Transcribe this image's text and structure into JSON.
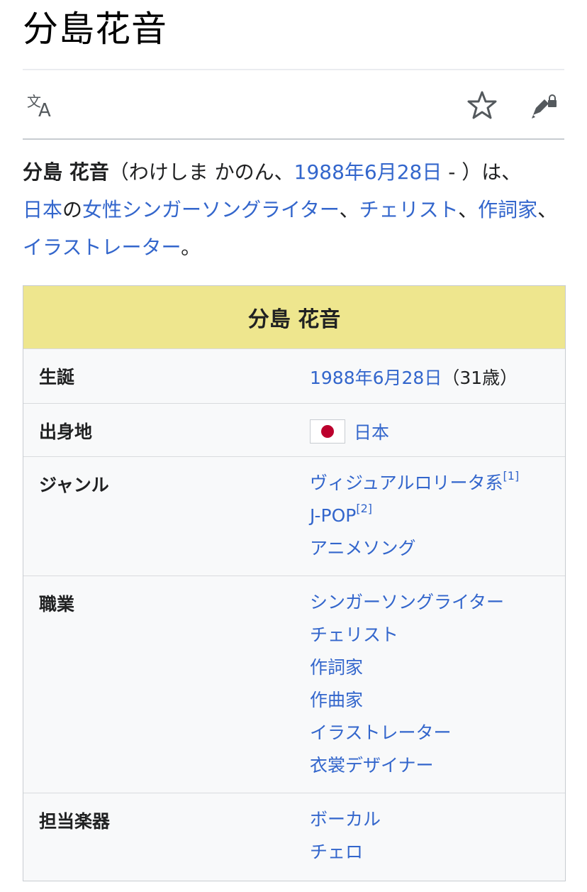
{
  "page": {
    "title": "分島花音"
  },
  "toolbar": {
    "language_icon": "language-icon",
    "watch_icon": "star-icon",
    "edit_icon": "edit-lock-icon"
  },
  "intro": {
    "name_bold": "分島 花音",
    "reading": "（わけしま かのん、",
    "birth_link": "1988年6月28日",
    "after_birth": " - ）は、",
    "country_link": "日本",
    "particle_no": "の",
    "role1_link": "女性シンガーソングライター",
    "sep1": "、",
    "role2_link": "チェリスト",
    "sep2": "、",
    "role3_link": "作詞家",
    "sep3": "、",
    "role4_link": "イラストレーター",
    "end": "。"
  },
  "infobox": {
    "header": "分島 花音",
    "colors": {
      "header_bg": "#eee68e",
      "link": "#3366cc"
    },
    "rows": [
      {
        "label": "生誕",
        "date_link": "1988年6月28日",
        "age": "（31歳）"
      },
      {
        "label": "出身地",
        "flag_icon": "japan-flag-icon",
        "value": "日本"
      },
      {
        "label": "ジャンル",
        "values": [
          "ヴィジュアルロリータ系",
          "J-POP",
          "アニメソング"
        ],
        "refs": [
          "[1]",
          "[2]"
        ]
      },
      {
        "label": "職業",
        "values": [
          "シンガーソングライター",
          "チェリスト",
          "作詞家",
          "作曲家",
          "イラストレーター",
          "衣裳デザイナー"
        ]
      },
      {
        "label": "担当楽器",
        "values": [
          "ボーカル",
          "チェロ"
        ]
      }
    ]
  }
}
